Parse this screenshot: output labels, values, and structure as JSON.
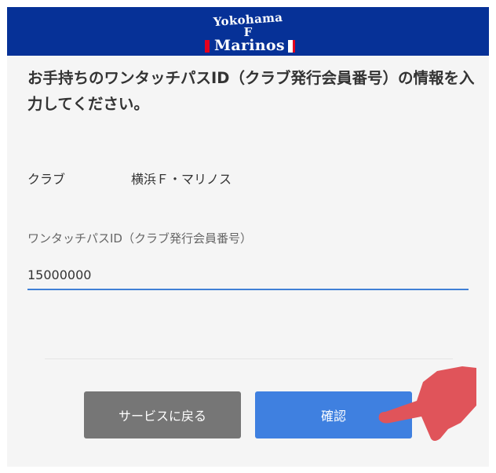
{
  "header": {
    "logo_line1": "Yokohama",
    "logo_line2": "F",
    "logo_line3": "Marinos",
    "background_color": "#063197"
  },
  "instruction": "お手持ちのワンタッチパスID（クラブ発行会員番号）の情報を入力してください。",
  "club": {
    "label": "クラブ",
    "value": "横浜Ｆ・マリノス"
  },
  "one_touch_pass": {
    "label": "ワンタッチパスID（クラブ発行会員番号）",
    "value": "15000000"
  },
  "buttons": {
    "back_label": "サービスに戻る",
    "confirm_label": "確認"
  },
  "colors": {
    "accent": "#3f80e0",
    "secondary_button": "#767676",
    "pointer": "#e0545a"
  },
  "icons": {
    "pointer": "hand-pointer-icon"
  }
}
